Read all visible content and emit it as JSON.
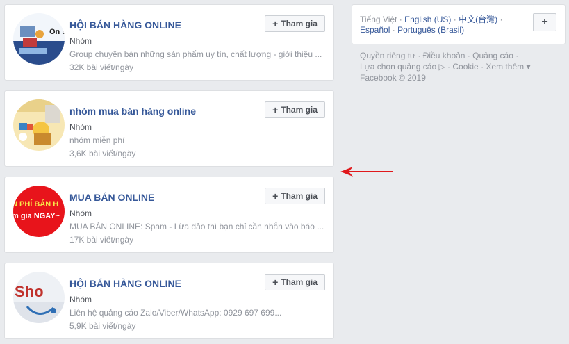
{
  "groups": [
    {
      "title": "HỘI BÁN HÀNG ONLINE",
      "type": "Nhóm",
      "description": "Group chuyên bán những sản phẩm uy tín, chất lượng - giới thiệu ...",
      "posts": "32K bài viết/ngày",
      "join_label": "Tham gia",
      "avatar_text": "On Sh"
    },
    {
      "title": "nhóm mua bán hàng online",
      "type": "Nhóm",
      "description": "nhóm miễn phí",
      "posts": "3,6K bài viết/ngày",
      "join_label": "Tham gia"
    },
    {
      "title": "MUA BÁN ONLINE",
      "type": "Nhóm",
      "description": "MUA BÁN ONLINE: Spam - Lừa đảo thì bạn chỉ cần nhắn vào báo ...",
      "posts": "17K bài viết/ngày",
      "join_label": "Tham gia",
      "avatar_text_1": "N PHÍ BÁN H",
      "avatar_text_2": "m gia NGAY~"
    },
    {
      "title": "HỘI BÁN HÀNG ONLINE",
      "type": "Nhóm",
      "description": "Liên hệ quảng cáo Zalo/Viber/WhatsApp: 0929 697 699...",
      "posts": "5,9K bài viết/ngày",
      "join_label": "Tham gia",
      "avatar_text": "Sho"
    }
  ],
  "languages": {
    "current": "Tiếng Việt",
    "options": [
      "English (US)",
      "中文(台灣)",
      "Español",
      "Português (Brasil)"
    ],
    "add_label": "+"
  },
  "footer": {
    "links_row1": [
      "Quyền riêng tư",
      "Điều khoản",
      "Quảng cáo"
    ],
    "links_row2": [
      "Lựa chọn quảng cáo ▷",
      "Cookie",
      "Xem thêm ▾"
    ],
    "copyright": "Facebook © 2019"
  },
  "colors": {
    "link_blue": "#365899",
    "annotation_arrow": "#e0181b"
  }
}
